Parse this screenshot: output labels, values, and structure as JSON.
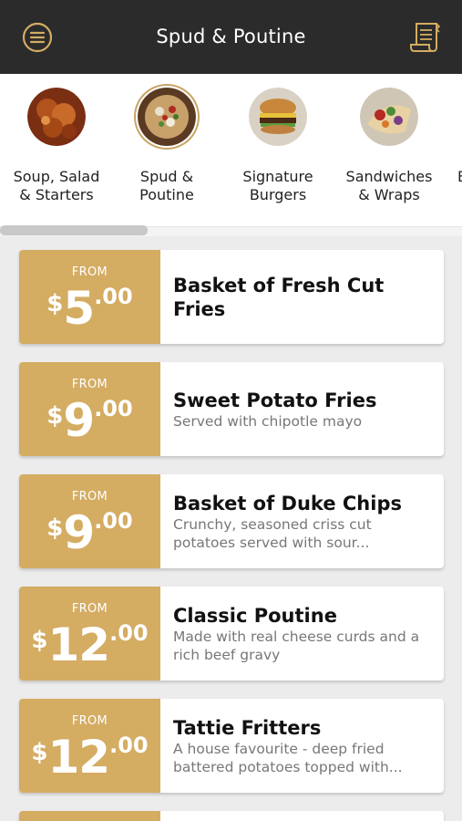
{
  "header": {
    "title": "Spud & Poutine",
    "left_icon": "menu-icon",
    "right_icon": "receipt-icon"
  },
  "categories": [
    {
      "label_line1": "Soup, Salad",
      "label_line2": "& Starters",
      "selected": false
    },
    {
      "label_line1": "Spud &",
      "label_line2": "Poutine",
      "selected": true
    },
    {
      "label_line1": "Signature",
      "label_line2": "Burgers",
      "selected": false
    },
    {
      "label_line1": "Sandwiches",
      "label_line2": "& Wraps",
      "selected": false
    },
    {
      "label_line1": "B",
      "label_line2": "",
      "selected": false
    }
  ],
  "items": [
    {
      "from": "FROM",
      "currency": "$",
      "whole": "5",
      "cents": ".00",
      "name": "Basket of Fresh Cut Fries",
      "desc": ""
    },
    {
      "from": "FROM",
      "currency": "$",
      "whole": "9",
      "cents": ".00",
      "name": "Sweet Potato Fries",
      "desc": "Served with chipotle mayo"
    },
    {
      "from": "FROM",
      "currency": "$",
      "whole": "9",
      "cents": ".00",
      "name": "Basket of Duke Chips",
      "desc": "Crunchy, seasoned criss cut potatoes served with sour..."
    },
    {
      "from": "FROM",
      "currency": "$",
      "whole": "12",
      "cents": ".00",
      "name": "Classic Poutine",
      "desc": "Made with real cheese curds and a rich beef gravy"
    },
    {
      "from": "FROM",
      "currency": "$",
      "whole": "12",
      "cents": ".00",
      "name": "Tattie Fritters",
      "desc": "A house favourite - deep fried battered potatoes topped with..."
    }
  ],
  "colors": {
    "header_bg": "#2b2b2b",
    "accent_gold": "#d4ac62",
    "page_bg": "#ececec"
  }
}
